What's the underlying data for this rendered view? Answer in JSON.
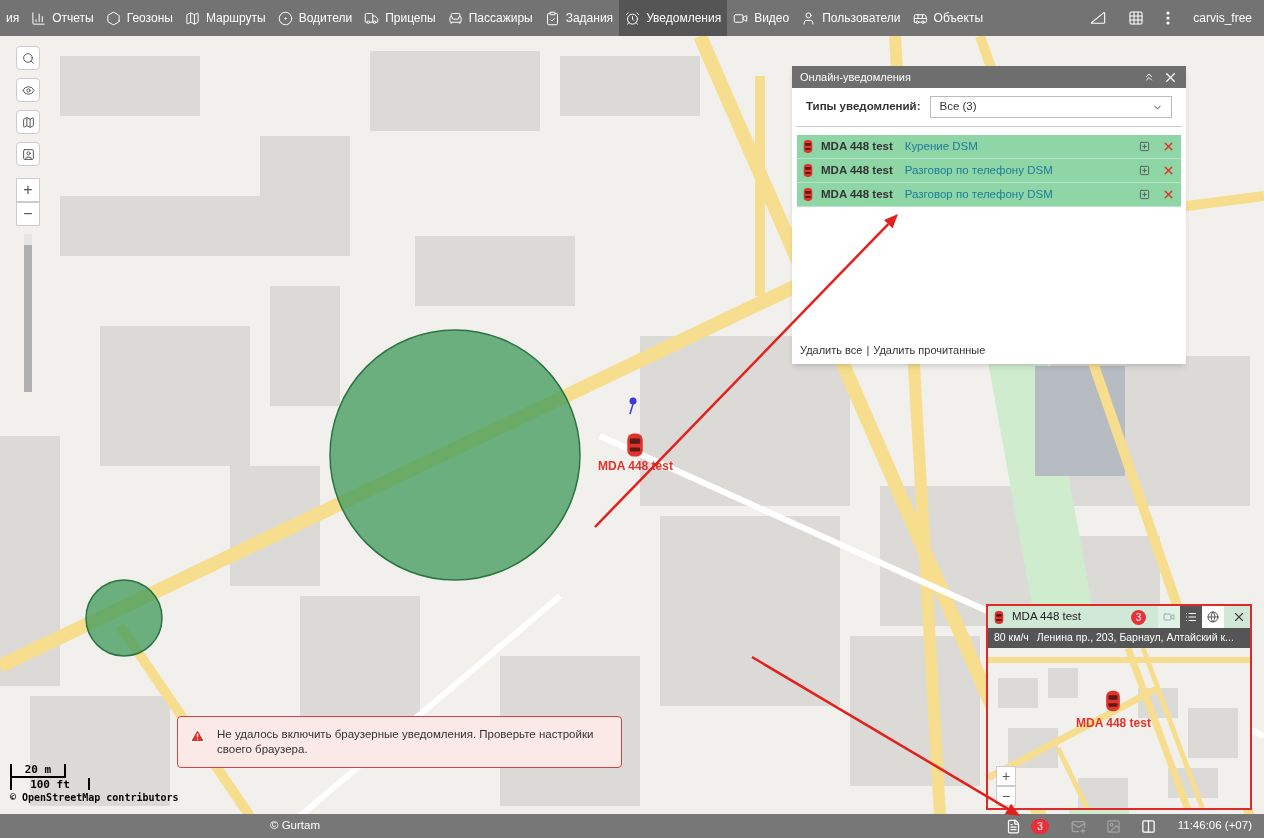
{
  "nav": {
    "items": [
      {
        "label": "ия",
        "kind": "none",
        "selected": false
      },
      {
        "label": "Отчеты",
        "kind": "report",
        "selected": false
      },
      {
        "label": "Геозоны",
        "kind": "geofence",
        "selected": false
      },
      {
        "label": "Маршруты",
        "kind": "route",
        "selected": false
      },
      {
        "label": "Водители",
        "kind": "wheel",
        "selected": false
      },
      {
        "label": "Прицепы",
        "kind": "trailer",
        "selected": false
      },
      {
        "label": "Пассажиры",
        "kind": "seat",
        "selected": false
      },
      {
        "label": "Задания",
        "kind": "task",
        "selected": false
      },
      {
        "label": "Уведомления",
        "kind": "alarm",
        "selected": true
      },
      {
        "label": "Видео",
        "kind": "video",
        "selected": false
      },
      {
        "label": "Пользователи",
        "kind": "user",
        "selected": false
      },
      {
        "label": "Объекты",
        "kind": "bus",
        "selected": false
      }
    ],
    "tools": [
      {
        "kind": "ruler"
      },
      {
        "kind": "grid"
      },
      {
        "kind": "more"
      }
    ],
    "user": "carvis_free"
  },
  "map_controls": {
    "buttons": [
      {
        "kind": "search"
      },
      {
        "kind": "eye"
      },
      {
        "kind": "map"
      },
      {
        "kind": "contact"
      }
    ],
    "zoom_in": "+",
    "zoom_out": "−",
    "zoom_slider": {
      "level": 0.93
    }
  },
  "unit": {
    "name": "MDA 448 test"
  },
  "scale": {
    "metric": "20 m",
    "imperial": "100 ft"
  },
  "attribution": "© OpenStreetMap contributors",
  "notifications_panel": {
    "title": "Онлайн-уведомления",
    "filter_label": "Типы уведомлений:",
    "filter_value": "Все (3)",
    "items": [
      {
        "unit": "MDA 448 test",
        "event": "Курение DSM"
      },
      {
        "unit": "MDA 448 test",
        "event": "Разговор по телефону DSM"
      },
      {
        "unit": "MDA 448 test",
        "event": "Разговор по телефону DSM"
      }
    ],
    "footer": {
      "delete_all": "Удалить все",
      "separator": "|",
      "delete_read": "Удалить прочитанные"
    }
  },
  "unit_window": {
    "title": "MDA 448 test",
    "badge": "3",
    "tabs": [
      {
        "kind": "video",
        "selected": false,
        "disabled": true
      },
      {
        "kind": "list",
        "selected": true,
        "disabled": false
      },
      {
        "kind": "globe",
        "selected": false,
        "disabled": false
      }
    ],
    "speed": "80 км/ч",
    "address": "Ленина пр., 203, Барнаул, Алтайский к...",
    "map_label": "MDA 448 test",
    "zoom_in": "+",
    "zoom_out": "−"
  },
  "toast": {
    "text": "Не удалось включить браузерные уведомления. Проверьте настройки своего браузера."
  },
  "status_bar": {
    "copyright": "© Gurtam",
    "badge": "3",
    "tools": [
      {
        "kind": "notifications",
        "disabled": false
      },
      {
        "kind": "mail",
        "disabled": true
      },
      {
        "kind": "image",
        "disabled": true
      },
      {
        "kind": "layout",
        "disabled": false
      }
    ],
    "time": "11:46:06 (+07)"
  }
}
